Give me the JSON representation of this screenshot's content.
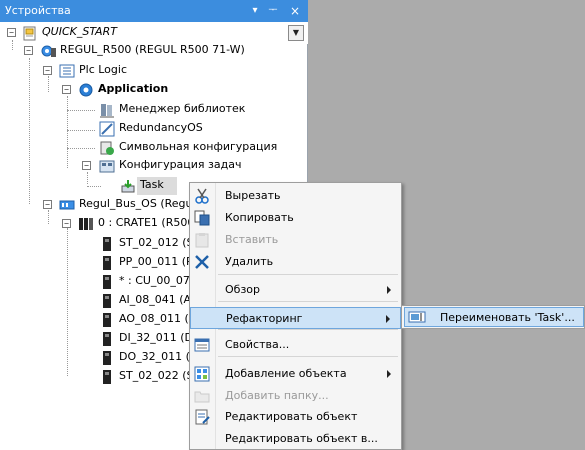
{
  "panel": {
    "title": "Устройства",
    "header_buttons": {
      "dropdown": "▾",
      "pin": "ᅮ",
      "close": "×"
    }
  },
  "tree": [
    {
      "key": "quick_start",
      "label": "QUICK_START",
      "icon": "project-icon",
      "expander": "−"
    },
    {
      "key": "regul_r500",
      "label": "REGUL_R500 (REGUL R500 71-W)",
      "icon": "device-gear-icon",
      "expander": "−"
    },
    {
      "key": "plc_logic",
      "label": "Plc Logic",
      "icon": "plc-logic-icon",
      "expander": "−"
    },
    {
      "key": "application",
      "label": "Application",
      "icon": "application-gear-icon",
      "expander": "−"
    },
    {
      "key": "lib_manager",
      "label": "Менеджер библиотек",
      "icon": "library-manager-icon"
    },
    {
      "key": "redundancy",
      "label": "RedundancyOS",
      "icon": "redundancy-icon"
    },
    {
      "key": "symbol_config",
      "label": "Символьная конфигурация",
      "icon": "symbol-config-icon"
    },
    {
      "key": "task_config",
      "label": "Конфигурация задач",
      "icon": "task-config-icon",
      "expander": "−"
    },
    {
      "key": "task",
      "label": "Task",
      "icon": "task-icon"
    },
    {
      "key": "regul_bus",
      "label": "Regul_Bus_OS (Regul",
      "icon": "bus-icon",
      "expander": "−"
    },
    {
      "key": "crate1",
      "label": "0 : CRATE1 (R500",
      "icon": "crate-icon",
      "expander": "−"
    },
    {
      "key": "st_02_012",
      "label": "ST_02_012 (S",
      "icon": "module-icon"
    },
    {
      "key": "pp_00_011",
      "label": "PP_00_011 (P",
      "icon": "module-icon"
    },
    {
      "key": "cu_00_07",
      "label": "* : CU_00_07",
      "icon": "module-icon"
    },
    {
      "key": "ai_08_041",
      "label": "AI_08_041 (A",
      "icon": "module-icon"
    },
    {
      "key": "ao_08_011",
      "label": "AO_08_011 (A",
      "icon": "module-icon"
    },
    {
      "key": "di_32_011",
      "label": "DI_32_011 (D",
      "icon": "module-icon"
    },
    {
      "key": "do_32_011",
      "label": "DO_32_011 (D",
      "icon": "module-icon"
    },
    {
      "key": "st_02_022",
      "label": "ST_02_022 (S",
      "icon": "module-icon"
    }
  ],
  "context_menu": {
    "items": [
      {
        "key": "cut",
        "label": "Вырезать",
        "icon": "scissors-icon"
      },
      {
        "key": "copy",
        "label": "Копировать",
        "icon": "copy-icon"
      },
      {
        "key": "paste",
        "label": "Вставить",
        "icon": "paste-icon",
        "disabled": true
      },
      {
        "key": "delete",
        "label": "Удалить",
        "icon": "delete-x-icon"
      },
      {
        "key": "browse",
        "label": "Обзор",
        "submenu": true
      },
      {
        "key": "refactoring",
        "label": "Рефакторинг",
        "submenu": true,
        "highlighted": true
      },
      {
        "key": "properties",
        "label": "Свойства...",
        "icon": "properties-icon"
      },
      {
        "key": "add_object",
        "label": "Добавление объекта",
        "icon": "add-object-icon",
        "submenu": true
      },
      {
        "key": "add_folder",
        "label": "Добавить папку...",
        "icon": "add-folder-icon",
        "disabled": true
      },
      {
        "key": "edit_object",
        "label": "Редактировать объект",
        "icon": "edit-object-icon"
      },
      {
        "key": "edit_object_with",
        "label": "Редактировать объект в..."
      }
    ]
  },
  "submenu": {
    "rename": "Переименовать 'Task'..."
  },
  "colors": {
    "header": "#3c8dde",
    "highlight": "#cde3f7",
    "highlight_border": "#6ea6dd",
    "background": "#ababab"
  }
}
